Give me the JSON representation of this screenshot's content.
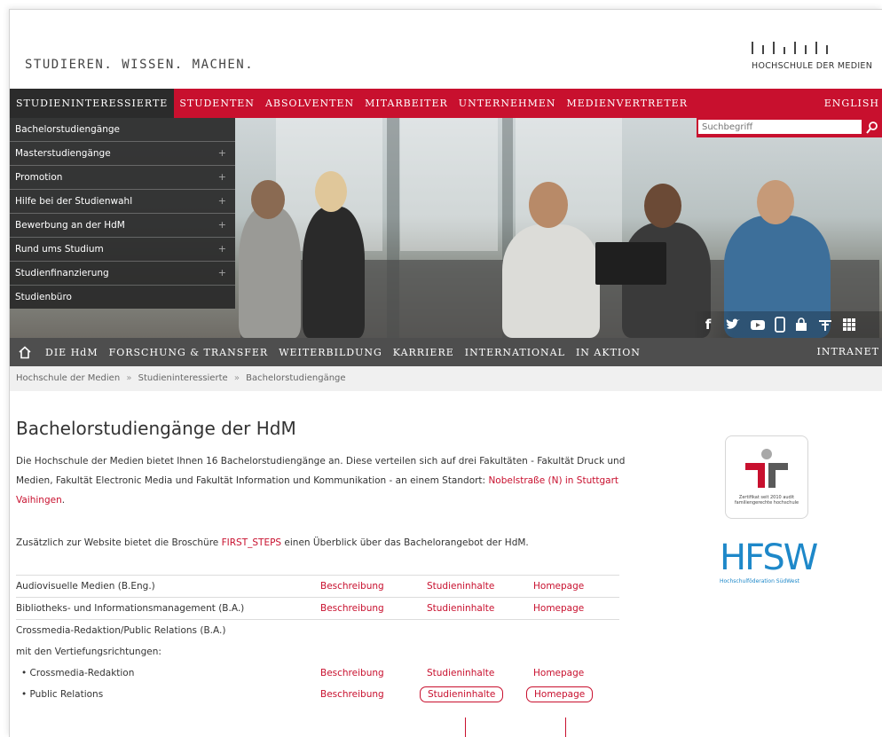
{
  "header": {
    "tagline": "STUDIEREN. WISSEN. MACHEN.",
    "logo_text": "HOCHSCHULE DER MEDIEN"
  },
  "topnav": {
    "items": [
      "STUDIENINTERESSIERTE",
      "STUDENTEN",
      "ABSOLVENTEN",
      "MITARBEITER",
      "UNTERNEHMEN",
      "MEDIENVERTRETER"
    ],
    "english": "ENGLISH"
  },
  "search": {
    "placeholder": "Suchbegriff"
  },
  "dropdown": {
    "items": [
      {
        "label": "Bachelorstudiengänge",
        "plus": ""
      },
      {
        "label": "Masterstudiengänge",
        "plus": "+"
      },
      {
        "label": "Promotion",
        "plus": "+"
      },
      {
        "label": "Hilfe bei der Studienwahl",
        "plus": "+"
      },
      {
        "label": "Bewerbung an der HdM",
        "plus": "+"
      },
      {
        "label": "Rund ums Studium",
        "plus": "+"
      },
      {
        "label": "Studienfinanzierung",
        "plus": "+"
      },
      {
        "label": "Studienbüro",
        "plus": ""
      }
    ]
  },
  "subnav": {
    "items": [
      "DIE HdM",
      "FORSCHUNG & TRANSFER",
      "WEITERBILDUNG",
      "KARRIERE",
      "INTERNATIONAL",
      "IN AKTION"
    ],
    "intranet": "INTRANET"
  },
  "breadcrumb": {
    "items": [
      "Hochschule der Medien",
      "Studieninteressierte",
      "Bachelorstudiengänge"
    ],
    "separator": "»"
  },
  "main": {
    "title": "Bachelorstudiengänge der HdM",
    "intro_1": "Die Hochschule der Medien bietet Ihnen 16 Bachelorstudiengänge an. Diese verteilen sich auf drei Fakultäten - Fakultät Druck und Medien, Fakultät Electronic Media und Fakultät Information und Kommunikation - an einem Standort: ",
    "intro_link": "Nobelstraße (N) in Stuttgart Vaihingen",
    "intro_end": ".",
    "intro_2_a": "Zusätzlich zur Website bietet die Broschüre ",
    "intro_2_link": "FIRST_STEPS",
    "intro_2_b": " einen Überblick über das Bachelorangebot der HdM."
  },
  "table": {
    "link_desc": "Beschreibung",
    "link_content": "Studieninhalte",
    "link_home": "Homepage",
    "rows": [
      {
        "name": "Audiovisuelle Medien (B.Eng.)"
      },
      {
        "name": "Bibliotheks- und Informationsmanagement (B.A.)"
      },
      {
        "name": "Crossmedia-Redaktion/Public Relations (B.A.)"
      },
      {
        "name": "mit den Vertiefungsrichtungen:"
      },
      {
        "name": "Crossmedia-Redaktion"
      },
      {
        "name": "Public Relations"
      }
    ]
  },
  "sidebar": {
    "cert_text": "Zertifikat seit 2010 audit familiengerechte hochschule",
    "hfsw_logo": "HFSW",
    "hfsw_text": "Hochschulföderation SüdWest"
  },
  "colors": {
    "brand_red": "#c8102e",
    "dark_nav": "#4e4e4e",
    "hfsw_blue": "#1e88c9"
  }
}
